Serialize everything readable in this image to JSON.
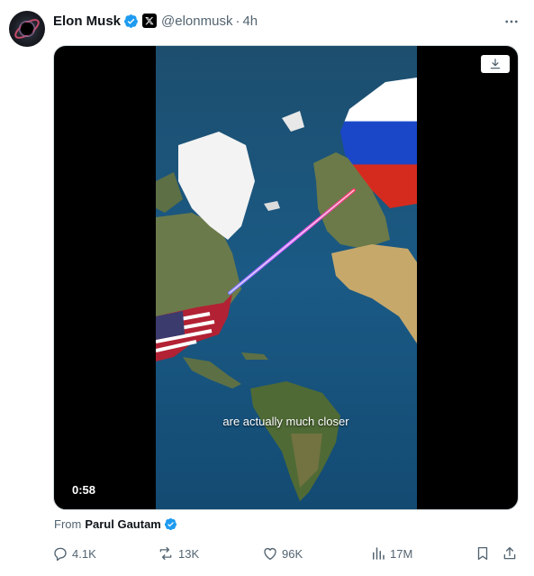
{
  "author": {
    "name": "Elon Musk",
    "handle": "@elonmusk",
    "time": "4h",
    "separator": "·",
    "verified_icon": "verified-badge-icon",
    "affiliate_icon": "x-logo-icon",
    "avatar_icon": "avatar-image"
  },
  "media": {
    "caption": "are actually much closer",
    "duration": "0:58",
    "download_icon": "download-icon"
  },
  "from": {
    "label": "From",
    "source": "Parul Gautam"
  },
  "actions": {
    "replies": "4.1K",
    "reposts": "13K",
    "likes": "96K",
    "views": "17M"
  },
  "colors": {
    "accent": "#1d9bf0",
    "muted": "#536471",
    "text": "#0f1419"
  }
}
